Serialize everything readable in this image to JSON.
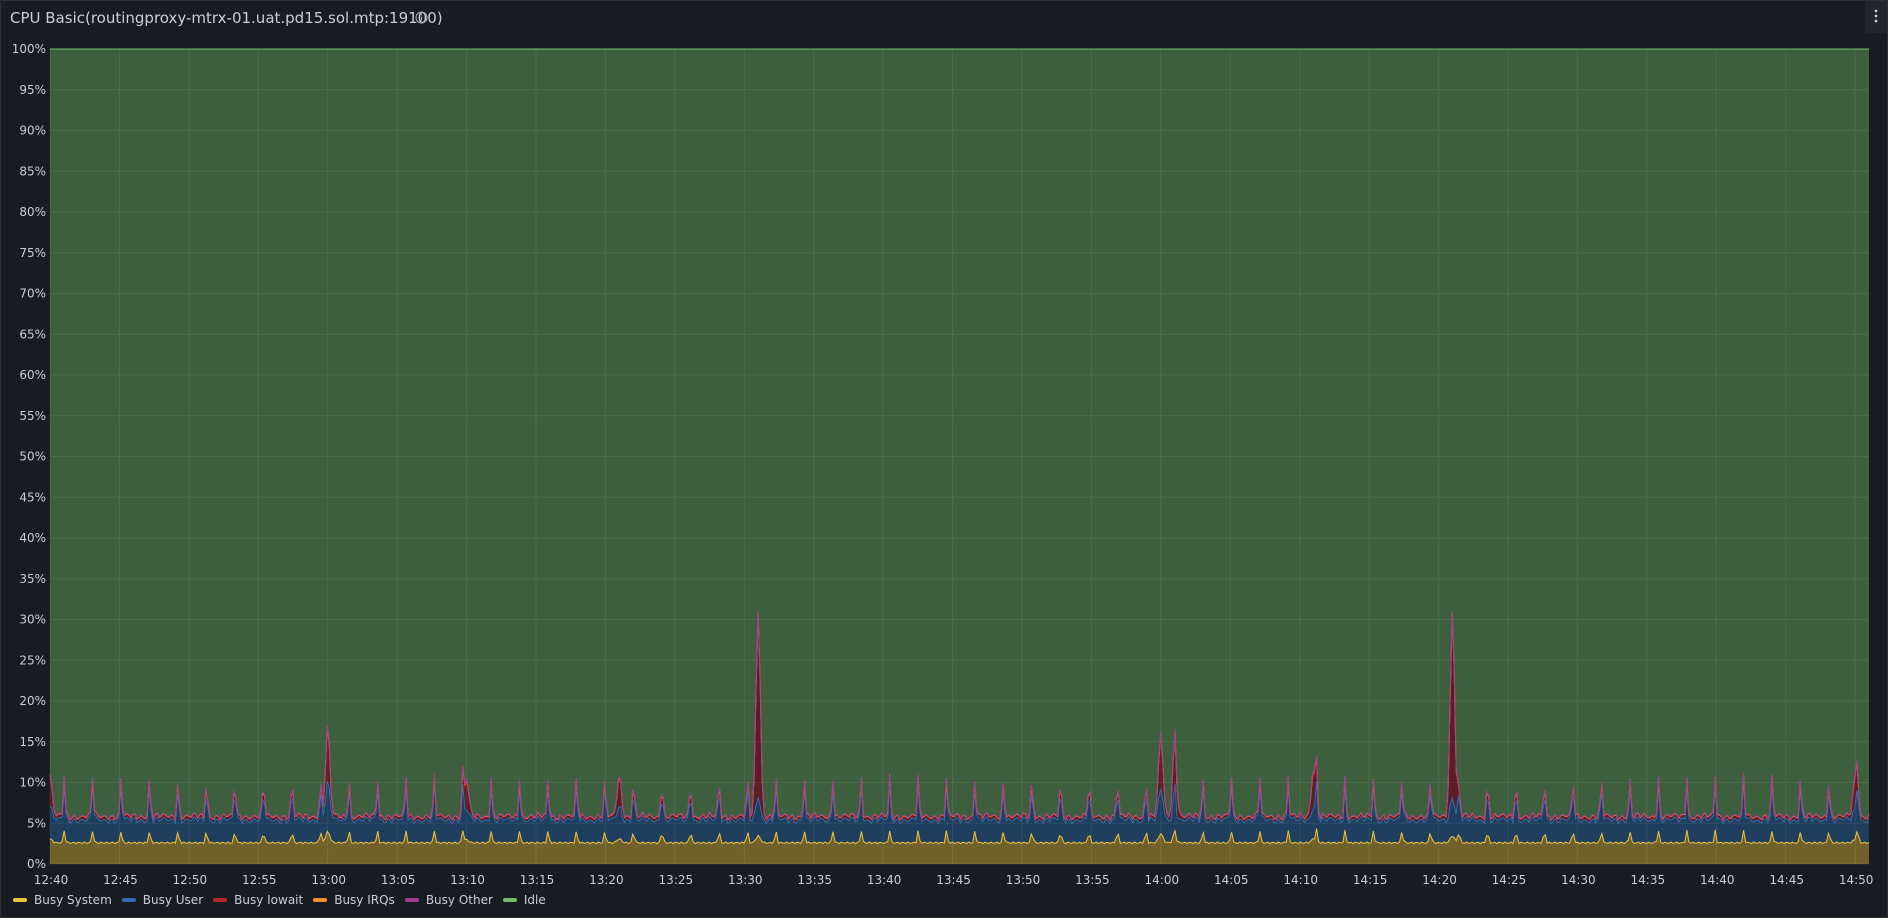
{
  "panel": {
    "title": "CPU Basic(routingproxy-mtrx-01.uat.pd15.sol.mtp:19100)",
    "info_icon": "info-circle-icon",
    "menu_icon": "kebab-menu-icon"
  },
  "colors": {
    "background": "#181b1f",
    "grid": "#2c3235",
    "busy_system": "#ecc43f",
    "busy_user": "#2e6fb3",
    "busy_iowait": "#b5262a",
    "busy_irqs": "#ff8c2a",
    "busy_other": "#a23f8f",
    "idle": "#73bf69"
  },
  "chart_data": {
    "type": "area",
    "stacked": true,
    "ylim": [
      0,
      100
    ],
    "y_unit": "%",
    "y_ticks": [
      "0%",
      "5%",
      "10%",
      "15%",
      "20%",
      "25%",
      "30%",
      "35%",
      "40%",
      "45%",
      "50%",
      "55%",
      "60%",
      "65%",
      "70%",
      "75%",
      "80%",
      "85%",
      "90%",
      "95%",
      "100%"
    ],
    "x_ticks": [
      "12:40",
      "12:45",
      "12:50",
      "12:55",
      "13:00",
      "13:05",
      "13:10",
      "13:15",
      "13:20",
      "13:25",
      "13:30",
      "13:35",
      "13:40",
      "13:45",
      "13:50",
      "13:55",
      "14:00",
      "14:05",
      "14:10",
      "14:15",
      "14:20",
      "14:25",
      "14:30",
      "14:35",
      "14:40",
      "14:45",
      "14:50"
    ],
    "x_start": "12:40",
    "x_end": "14:51",
    "grid": true,
    "legend_position": "bottom",
    "series": [
      {
        "name": "Busy System",
        "color": "#ecc43f",
        "baseline": 2.6,
        "spike": 1.5
      },
      {
        "name": "Busy User",
        "color": "#2e6fb3",
        "baseline": 2.8,
        "spike": 2.5
      },
      {
        "name": "Busy Iowait",
        "color": "#b5262a",
        "baseline": 0.4,
        "spike": 0.8
      },
      {
        "name": "Busy IRQs",
        "color": "#ff8c2a",
        "baseline": 0.05,
        "spike": 0.1
      },
      {
        "name": "Busy Other",
        "color": "#a23f8f",
        "baseline": 0.05,
        "spike": 0.1
      },
      {
        "name": "Idle",
        "color": "#73bf69",
        "baseline": 94.1,
        "spike": 0
      }
    ],
    "notable_spikes": [
      {
        "time": "13:00",
        "total": 17.5,
        "iowait": 6
      },
      {
        "time": "13:31",
        "total": 31.5,
        "iowait": 22
      },
      {
        "time": "14:00",
        "total": 16.5,
        "iowait": 6
      },
      {
        "time": "14:01",
        "total": 12.5,
        "iowait": 5
      },
      {
        "time": "14:21",
        "total": 31.5,
        "iowait": 22
      },
      {
        "time": "13:10",
        "total": 10.5,
        "iowait": 3
      },
      {
        "time": "14:11",
        "total": 12,
        "iowait": 4
      },
      {
        "time": "12:40",
        "total": 11,
        "iowait": 3
      },
      {
        "time": "13:21",
        "total": 11,
        "iowait": 3
      },
      {
        "time": "14:50",
        "total": 10.5,
        "iowait": 3
      }
    ]
  },
  "legend": [
    {
      "label": "Busy System",
      "color": "#ecc43f"
    },
    {
      "label": "Busy User",
      "color": "#2e6fb3"
    },
    {
      "label": "Busy Iowait",
      "color": "#b5262a"
    },
    {
      "label": "Busy IRQs",
      "color": "#ff8c2a"
    },
    {
      "label": "Busy Other",
      "color": "#a23f8f"
    },
    {
      "label": "Idle",
      "color": "#73bf69"
    }
  ]
}
